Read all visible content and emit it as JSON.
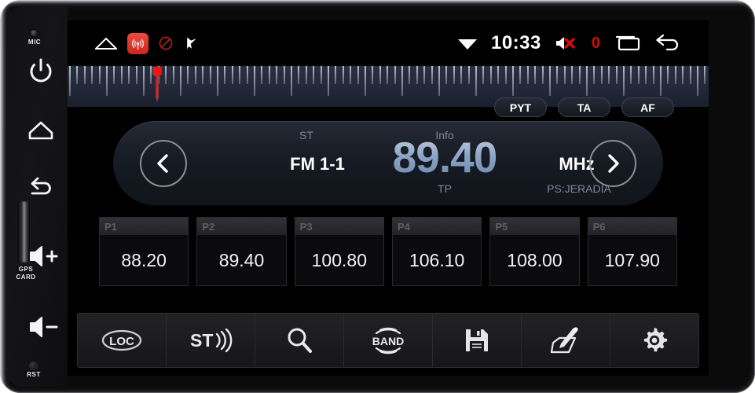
{
  "device": {
    "bezel": {
      "mic_label": "MIC",
      "gps_label_line1": "GPS",
      "gps_label_line2": "CARD",
      "reset_label": "RST",
      "buttons": [
        {
          "name": "power-button",
          "icon": "power-icon"
        },
        {
          "name": "home-button",
          "icon": "home-icon"
        },
        {
          "name": "back-button",
          "icon": "back-arrow-icon"
        },
        {
          "name": "volume-up-button",
          "icon": "speaker-plus-icon"
        },
        {
          "name": "volume-down-button",
          "icon": "speaker-minus-icon"
        }
      ]
    }
  },
  "statusbar": {
    "left_icons": [
      {
        "name": "home-icon",
        "label": "home-icon"
      },
      {
        "name": "radio-app-icon",
        "label": "radio-broadcast-icon"
      },
      {
        "name": "no-entry-icon",
        "label": "do-not-disturb-icon"
      },
      {
        "name": "flag-check-icon",
        "label": "flag-check-icon"
      }
    ],
    "wifi_icon": "wifi-icon",
    "time": "10:33",
    "mute_icon": "speaker-muted-icon",
    "volume_value": "0",
    "recents_icon": "recent-apps-icon",
    "back_icon": "back-arrow-icon",
    "accent_red": "#d60a0a"
  },
  "tuner": {
    "cursor_position_pct": 14.0,
    "scale_accent": "#ff1111"
  },
  "radio": {
    "prev_label": "prev-station",
    "next_label": "next-station",
    "stereo_label": "ST",
    "info_label": "Info",
    "band": "FM 1-1",
    "frequency": "89.40",
    "unit": "MHz",
    "tp_label": "TP",
    "ps_label": "PS:JERADIA",
    "frequency_color": "#8ea6c6",
    "rds_chips": [
      {
        "label": "PYT"
      },
      {
        "label": "TA"
      },
      {
        "label": "AF"
      }
    ]
  },
  "presets": [
    {
      "num": "P1",
      "freq": "88.20"
    },
    {
      "num": "P2",
      "freq": "89.40"
    },
    {
      "num": "P3",
      "freq": "100.80"
    },
    {
      "num": "P4",
      "freq": "106.10"
    },
    {
      "num": "P5",
      "freq": "108.00"
    },
    {
      "num": "P6",
      "freq": "107.90"
    }
  ],
  "toolbar": [
    {
      "name": "loc-button",
      "icon": "loc-icon",
      "label": "LOC"
    },
    {
      "name": "stereo-button",
      "icon": "stereo-waves-icon",
      "label": "ST"
    },
    {
      "name": "scan-button",
      "icon": "search-icon",
      "label": ""
    },
    {
      "name": "band-button",
      "icon": "band-icon",
      "label": "BAND"
    },
    {
      "name": "save-button",
      "icon": "floppy-save-icon",
      "label": ""
    },
    {
      "name": "edit-button",
      "icon": "pencil-edit-icon",
      "label": ""
    },
    {
      "name": "settings-button",
      "icon": "gear-icon",
      "label": ""
    }
  ]
}
